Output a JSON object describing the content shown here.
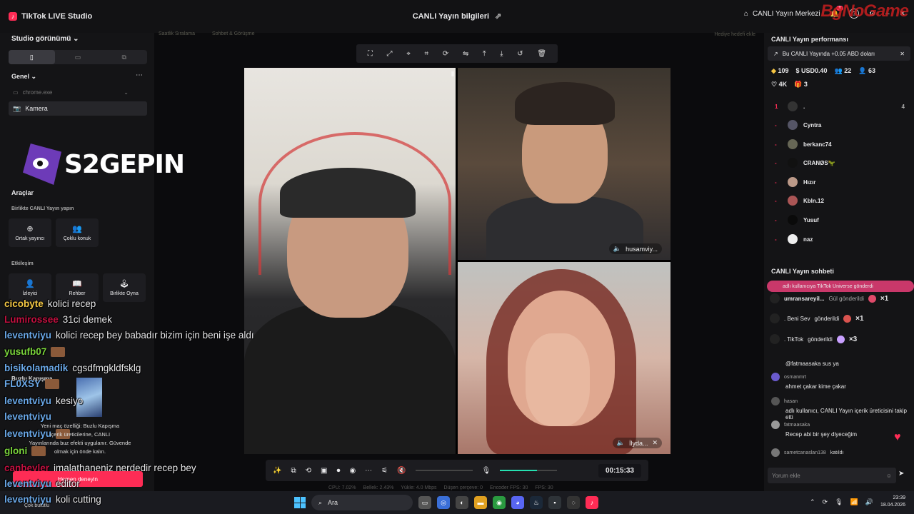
{
  "app": {
    "title": "TikTok LIVE Studio",
    "center_title": "CANLI Yayın bilgileri",
    "hub_label": "CANLI Yayın Merkezi",
    "notif_count": "1",
    "watermark": "BgNoGame"
  },
  "left": {
    "studio_view": "Studio görünümü",
    "genel": "Genel",
    "sources": [
      "chrome.exe",
      "Kamera"
    ],
    "brand": "S2GEPIN",
    "araclar": "Araçlar",
    "birlikte": "Birlikte CANLI Yayın yapın",
    "tools1": [
      "Ortak yayıncı",
      "Çoklu konuk"
    ],
    "etkilesim": "Etkileşim",
    "tools2": [
      "İzleyici",
      "Rehber",
      "Birlikte Oyna"
    ],
    "buzlu": "Buzlu Kapışma"
  },
  "center": {
    "faint_tabs": [
      "Saatlik Sıralama",
      "Sohbet & Görüşme"
    ],
    "gift_goal": "Hediye hedefi ekle",
    "tile2_label": "husamviy...",
    "tile3_label": "İlyda...",
    "timer": "00:15:33",
    "mic_level": 0.65,
    "stats": [
      "CPU: 7.02%",
      "Bellek: 2.43%",
      "Yükle: 4.0 Mbps",
      "Düşen çerçeve: 0",
      "Encoder FPS: 30",
      "FPS: 30"
    ]
  },
  "right": {
    "perf_header": "CANLI Yayın performansı",
    "earn_text": "Bu CANLI Yayında +0.05 ABD doları",
    "metrics": {
      "diamonds": "109",
      "usd": "USD0.40",
      "viewers": "22",
      "new": "63",
      "likes": "4K",
      "gifts": "3"
    },
    "ranks": [
      {
        "num": "1",
        "name": ".",
        "val": "4"
      },
      {
        "num": "-",
        "name": "Cyntra",
        "val": ""
      },
      {
        "num": "-",
        "name": "berkanc74",
        "val": ""
      },
      {
        "num": "-",
        "name": "CRANØS🦖",
        "val": ""
      },
      {
        "num": "-",
        "name": "Hızır",
        "val": ""
      },
      {
        "num": "-",
        "name": "Kbln.12",
        "val": ""
      },
      {
        "num": "-",
        "name": "Yusuf",
        "val": ""
      },
      {
        "num": "-",
        "name": "naz",
        "val": ""
      }
    ],
    "chat_header": "CANLI Yayın sohbeti",
    "gift_banner": "adlı kullanıcıya TikTok Universe gönderdi",
    "gift_rows": [
      {
        "user": "umransareyil...",
        "action": "Gül gönderildi",
        "mult": "×1",
        "color": "#e04a6a"
      },
      {
        "user": ". Beni Sev",
        "action": "gönderildi",
        "mult": "×1",
        "color": "#d9534f"
      },
      {
        "user": ". TikTok",
        "action": "gönderildi",
        "mult": "×3",
        "color": "#c9a0ff"
      }
    ],
    "comments": [
      {
        "user": "",
        "text": "@fatmaasaka sus ya"
      },
      {
        "user": "osmanmrt",
        "text": "ahmet çakar kime çakar"
      },
      {
        "user": "hasan",
        "text": "adlı kullanıcı, CANLI Yayın içerik üreticisini takip etti"
      },
      {
        "user": "fatmaasaka",
        "text": "Recep abi bir şey diyeceğim"
      },
      {
        "user": "sametcanaslan138",
        "text": "katıldı"
      }
    ],
    "comment_placeholder": "Yorum ekle"
  },
  "overlay_chat": [
    {
      "name": "cicobyte",
      "color": "#f6c945",
      "text": "kolici recep"
    },
    {
      "name": "Lumirossee",
      "color": "#c21040",
      "text": "31ci demek"
    },
    {
      "name": "leventviyu",
      "color": "#6aa8e8",
      "text": "kolici recep bey babadır bizim için beni işe aldı"
    },
    {
      "name": "yusufb07",
      "color": "#7ad43c",
      "text": ""
    },
    {
      "name": "bisikolamadik",
      "color": "#6aa8e8",
      "text": "cgsdfmgkldfsklg"
    },
    {
      "name": "FL0XSY",
      "color": "#6aa8e8",
      "text": ""
    },
    {
      "name": "leventviyu",
      "color": "#6aa8e8",
      "text": "kesiyo"
    },
    {
      "name": "leventviyu",
      "color": "#6aa8e8",
      "text": ""
    },
    {
      "name": "leventviyu",
      "color": "#6aa8e8",
      "text": ""
    },
    {
      "name": "gloni",
      "color": "#7ad43c",
      "text": ""
    },
    {
      "name": "canbeyler",
      "color": "#c21040",
      "text": "imalathaneniz nerdedir recep bey"
    },
    {
      "name": "leventviyu",
      "color": "#6aa8e8",
      "text": "editor"
    },
    {
      "name": "leventviyu",
      "color": "#6aa8e8",
      "text": "koli cutting"
    }
  ],
  "popup": {
    "text": "Yeni maç özelliği: Buzlu Kapışma\niçerik üreticilerine, CANLI\nYayınlarında buz efekti uygulanır. Güvende\nolmak için önde kalın.",
    "button": "Hemen deneyin",
    "close": "Çok bulutlu"
  },
  "taskbar": {
    "search": "Ara",
    "time": "23:39",
    "date": "18.04.2026"
  }
}
